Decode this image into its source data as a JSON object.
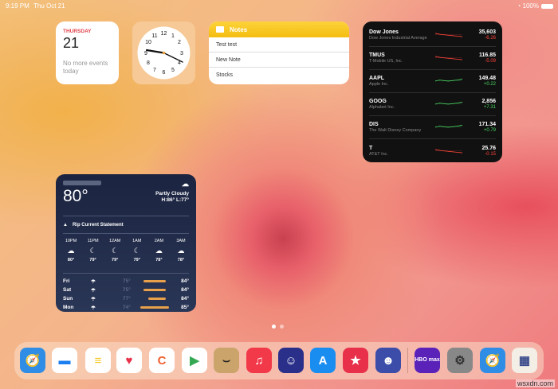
{
  "status": {
    "time": "9:19 PM",
    "date": "Thu Oct 21",
    "battery": "100%"
  },
  "calendar": {
    "weekday": "THURSDAY",
    "day": "21",
    "message": "No more events today"
  },
  "notes": {
    "title": "Notes",
    "items": [
      "Test test",
      "New Note",
      "Stocks"
    ]
  },
  "stocks": [
    {
      "symbol": "Dow Jones",
      "name": "Dow Jones Industrial Average",
      "price": "35,603",
      "change": "-6.26",
      "trend": "down"
    },
    {
      "symbol": "TMUS",
      "name": "T-Mobile US, Inc.",
      "price": "116.85",
      "change": "-5.09",
      "trend": "down"
    },
    {
      "symbol": "AAPL",
      "name": "Apple Inc.",
      "price": "149.48",
      "change": "+0.22",
      "trend": "up"
    },
    {
      "symbol": "GOOG",
      "name": "Alphabet Inc.",
      "price": "2,856",
      "change": "+7.31",
      "trend": "up"
    },
    {
      "symbol": "DIS",
      "name": "The Walt Disney Company",
      "price": "171.34",
      "change": "+0.79",
      "trend": "up"
    },
    {
      "symbol": "T",
      "name": "AT&T Inc.",
      "price": "25.76",
      "change": "-0.15",
      "trend": "down"
    }
  ],
  "weather": {
    "temp": "80°",
    "condition": "Partly Cloudy",
    "hilo": "H:86° L:77°",
    "alert": "Rip Current Statement",
    "hours": [
      {
        "t": "10PM",
        "v": "80°",
        "i": "cloud"
      },
      {
        "t": "11PM",
        "v": "79°",
        "i": "moon"
      },
      {
        "t": "12AM",
        "v": "79°",
        "i": "moon"
      },
      {
        "t": "1AM",
        "v": "79°",
        "i": "moon"
      },
      {
        "t": "2AM",
        "v": "78°",
        "i": "cloud"
      },
      {
        "t": "3AM",
        "v": "78°",
        "i": "cloud"
      }
    ],
    "days": [
      {
        "d": "Fri",
        "lo": "75°",
        "hi": "84°"
      },
      {
        "d": "Sat",
        "lo": "75°",
        "hi": "84°"
      },
      {
        "d": "Sun",
        "lo": "77°",
        "hi": "84°"
      },
      {
        "d": "Mon",
        "lo": "74°",
        "hi": "85°"
      }
    ]
  },
  "colors": {
    "up": "#4cd964",
    "down": "#ff453a"
  },
  "dock": [
    "Safari",
    "Files",
    "Notes",
    "Pocket",
    "Cascable",
    "Play Store",
    "Amazon",
    "Music",
    "Astro",
    "App Store",
    "Bookmark",
    "Game",
    "HBO Max",
    "Settings",
    "Safari",
    "Folder"
  ],
  "dock_labels": {
    "hbo": "HBO max"
  },
  "watermark": "wsxdn.com"
}
